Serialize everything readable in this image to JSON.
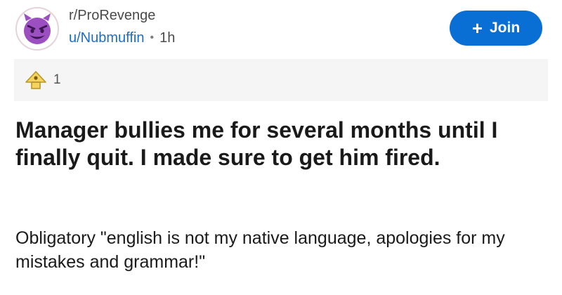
{
  "header": {
    "subreddit": "r/ProRevenge",
    "username": "u/Nubmuffin",
    "separator": "•",
    "age": "1h",
    "join_label": "Join",
    "join_icon": "plus-icon",
    "avatar_icon": "devil-emoji-icon"
  },
  "awards": {
    "icon": "helpful-award-icon",
    "count": "1"
  },
  "post": {
    "title": "Manager bullies me for several months until I finally quit. I made sure to get him fired.",
    "body": "Obligatory \"english is not my native language, apologies for my mistakes and grammar!\""
  },
  "colors": {
    "accent": "#0a6fd4",
    "username": "#1d6ec4",
    "award_bar_bg": "#f5f5f5",
    "avatar_purple": "#9b4fc0"
  }
}
